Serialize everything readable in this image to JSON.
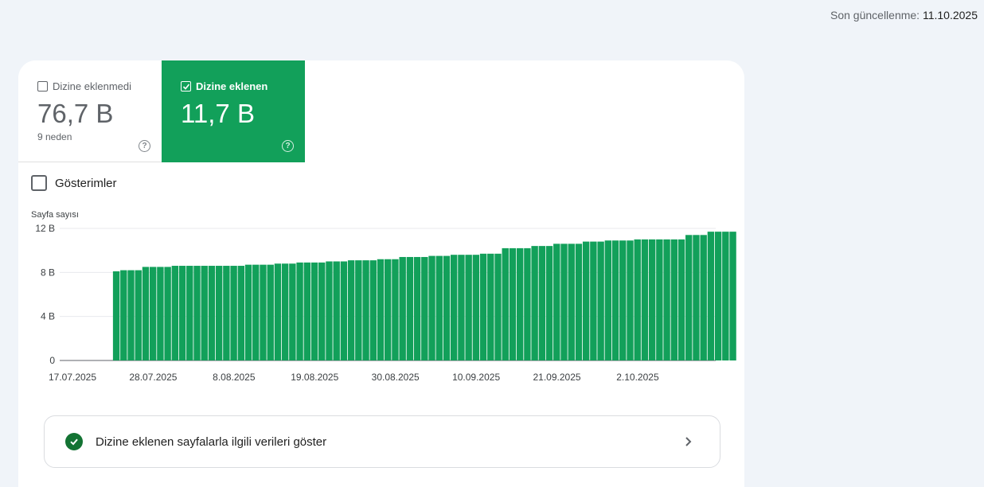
{
  "header": {
    "last_updated_label": "Son güncellenme:",
    "last_updated_value": "11.10.2025"
  },
  "tiles": {
    "not_indexed": {
      "label": "Dizine eklenmedi",
      "value": "76,7 B",
      "sub": "9 neden",
      "checked": false,
      "help": "?"
    },
    "indexed": {
      "label": "Dizine eklenen",
      "value": "11,7 B",
      "checked": true,
      "help": "?"
    }
  },
  "impressions": {
    "label": "Gösterimler",
    "checked": false
  },
  "chart_data": {
    "type": "bar",
    "ylabel": "Sayfa sayısı",
    "ylim": [
      0,
      12000
    ],
    "yticks": [
      0,
      4000,
      8000,
      12000
    ],
    "ytick_labels": [
      "0",
      "4 B",
      "8 B",
      "12 B"
    ],
    "xtick_labels": [
      "17.07.2025",
      "28.07.2025",
      "8.08.2025",
      "19.08.2025",
      "30.08.2025",
      "10.09.2025",
      "21.09.2025",
      "2.10.2025"
    ],
    "xtick_indices": [
      0,
      11,
      22,
      33,
      44,
      55,
      66,
      77
    ],
    "start_label": "17.07.2025",
    "bar_offset": 4,
    "color": "#12a05a",
    "values": [
      8100,
      8200,
      8200,
      8200,
      8500,
      8500,
      8500,
      8500,
      8600,
      8600,
      8600,
      8600,
      8600,
      8600,
      8600,
      8600,
      8600,
      8600,
      8700,
      8700,
      8700,
      8700,
      8800,
      8800,
      8800,
      8900,
      8900,
      8900,
      8900,
      9000,
      9000,
      9000,
      9100,
      9100,
      9100,
      9100,
      9200,
      9200,
      9200,
      9400,
      9400,
      9400,
      9400,
      9500,
      9500,
      9500,
      9600,
      9600,
      9600,
      9600,
      9700,
      9700,
      9700,
      10200,
      10200,
      10200,
      10200,
      10400,
      10400,
      10400,
      10600,
      10600,
      10600,
      10600,
      10800,
      10800,
      10800,
      10900,
      10900,
      10900,
      10900,
      11000,
      11000,
      11000,
      11000,
      11000,
      11000,
      11000,
      11400,
      11400,
      11400,
      11700,
      11700,
      11700,
      11700
    ]
  },
  "show_data": {
    "label": "Dizine eklenen sayfalarla ilgili verileri göster"
  },
  "colors": {
    "accent": "#12a05a",
    "background": "#f0f4f9",
    "check": "#137333"
  }
}
